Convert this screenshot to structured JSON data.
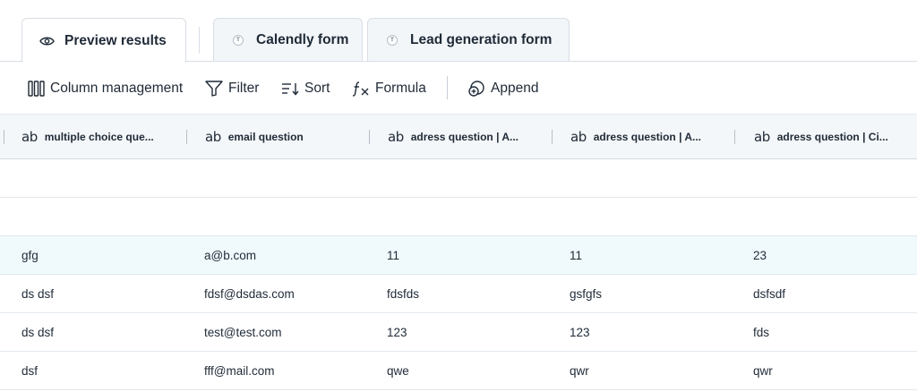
{
  "tabs": [
    {
      "label": "Preview results",
      "icon": "eye-icon",
      "active": true
    },
    {
      "label": "Calendly form",
      "icon": "typeform-badge-icon",
      "active": false
    },
    {
      "label": "Lead generation form",
      "icon": "typeform-badge-icon",
      "active": false
    }
  ],
  "tab_badge_letter": "T",
  "toolbar": {
    "column_management": "Column management",
    "filter": "Filter",
    "sort": "Sort",
    "formula": "Formula",
    "append": "Append"
  },
  "table": {
    "type_glyph": "ab",
    "columns": [
      "multiple choice que...",
      "email question",
      "adress question | A...",
      "adress question | A...",
      "adress question | Ci..."
    ],
    "rows": [
      [
        "",
        "",
        "",
        "",
        ""
      ],
      [
        "",
        "",
        "",
        "",
        ""
      ],
      [
        "gfg",
        "a@b.com",
        "11",
        "11",
        "23"
      ],
      [
        "ds dsf",
        "fdsf@dsdas.com",
        "fdsfds",
        "gsfgfs",
        "dsfsdf"
      ],
      [
        "ds dsf",
        "test@test.com",
        "123",
        "123",
        "fds"
      ],
      [
        "dsf",
        "fff@mail.com",
        "qwe",
        "qwr",
        "qwr"
      ]
    ],
    "highlighted_row": 2
  },
  "colors": {
    "text": "#1f2a37",
    "border": "#d9dee5",
    "header_bg": "#f4f7f9",
    "highlight_row_bg": "#f0fafd"
  }
}
